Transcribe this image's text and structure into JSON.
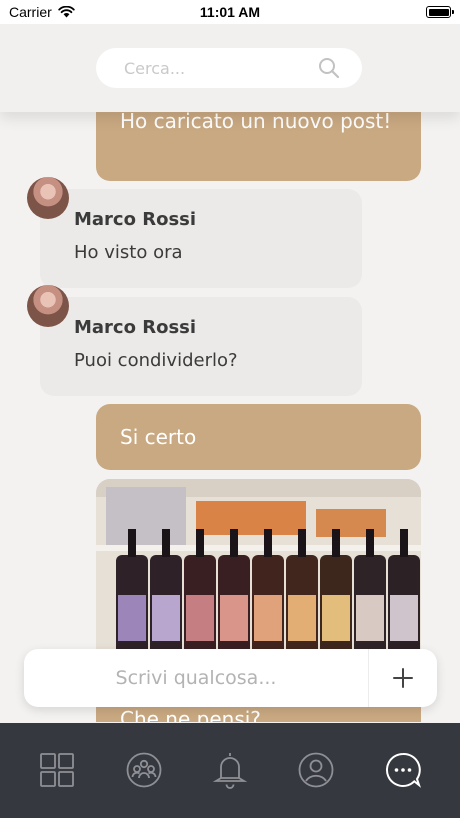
{
  "status_bar": {
    "carrier": "Carrier",
    "time": "11:01 AM"
  },
  "search": {
    "placeholder": "Cerca..."
  },
  "messages": [
    {
      "type": "outgoing",
      "text": "Ho caricato un nuovo post!"
    },
    {
      "type": "incoming",
      "sender": "Marco Rossi",
      "text": "Ho visto ora"
    },
    {
      "type": "incoming",
      "sender": "Marco Rossi",
      "text": "Puoi condividerlo?"
    },
    {
      "type": "outgoing",
      "text": "Si certo"
    },
    {
      "type": "outgoing-image"
    },
    {
      "type": "outgoing",
      "text": "Che ne pensi?"
    }
  ],
  "composer": {
    "placeholder": "Scrivi qualcosa..."
  },
  "tabs": [
    {
      "icon": "grid-icon",
      "active": false
    },
    {
      "icon": "community-icon",
      "active": false
    },
    {
      "icon": "bell-icon",
      "active": false
    },
    {
      "icon": "profile-icon",
      "active": false
    },
    {
      "icon": "chat-bubble-icon",
      "active": true
    }
  ],
  "colors": {
    "accent": "#c9a982",
    "incoming_bubble": "#ebeae8",
    "background": "#f3f2f0",
    "tab_bar": "#363840"
  }
}
